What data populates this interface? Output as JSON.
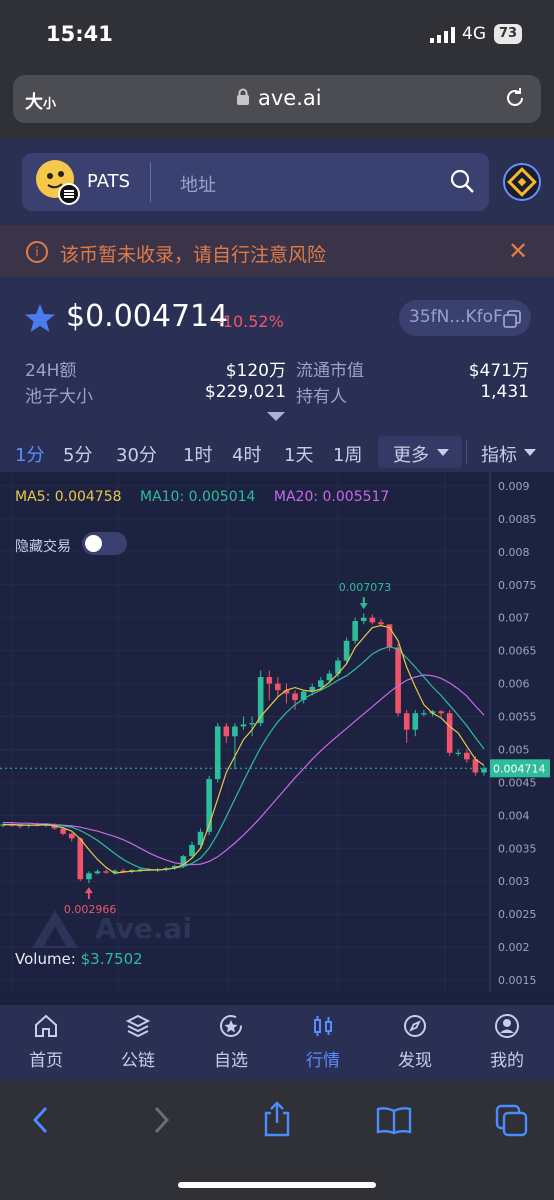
{
  "status_bar": {
    "time": "15:41",
    "network": "4G",
    "battery": "73"
  },
  "browser": {
    "text_size_label": "大",
    "text_size_small": "小",
    "domain": "ave.ai"
  },
  "header": {
    "coin_name": "PATS",
    "search_placeholder": "地址"
  },
  "warning": {
    "text": "该币暂未收录，请自行注意风险"
  },
  "price": {
    "value": "$0.004714",
    "change": "-10.52%",
    "address": "35fN...KfoF"
  },
  "stats": {
    "vol_label": "24H额",
    "vol_value": "$120万",
    "mcap_label": "流通市值",
    "mcap_value": "$471万",
    "pool_label": "池子大小",
    "pool_value": "$229,021",
    "holders_label": "持有人",
    "holders_value": "1,431"
  },
  "timeframes": [
    "1分",
    "5分",
    "30分",
    "1时",
    "4时",
    "1天",
    "1周"
  ],
  "timeframe_active": "1分",
  "more_label": "更多",
  "indicator_label": "指标",
  "chart_overlay": {
    "ma5": "MA5: 0.004758",
    "ma10": "MA10: 0.005014",
    "ma20": "MA20: 0.005517",
    "hide_trades": "隐藏交易",
    "volume_label": "Volume:",
    "volume_value": "$3.7502",
    "watermark": "Ave.ai"
  },
  "chart_data": {
    "type": "candlestick",
    "ylim": [
      0.0015,
      0.009
    ],
    "yticks": [
      "0.009",
      "0.0085",
      "0.008",
      "0.0075",
      "0.007",
      "0.0065",
      "0.006",
      "0.0055",
      "0.005",
      "0.0045",
      "0.004",
      "0.0035",
      "0.003",
      "0.0025",
      "0.002",
      "0.0015"
    ],
    "current_price": "0.004714",
    "high_label": "0.007073",
    "low_label": "0.002966",
    "series_ohlc": [
      [
        0.00385,
        0.00388,
        0.00382,
        0.00386
      ],
      [
        0.00386,
        0.0039,
        0.00383,
        0.00385
      ],
      [
        0.00385,
        0.00387,
        0.0038,
        0.00384
      ],
      [
        0.00384,
        0.00388,
        0.00381,
        0.00386
      ],
      [
        0.00386,
        0.00389,
        0.00383,
        0.00385
      ],
      [
        0.00385,
        0.00387,
        0.00382,
        0.00386
      ],
      [
        0.00386,
        0.00388,
        0.00378,
        0.0038
      ],
      [
        0.0038,
        0.00382,
        0.0037,
        0.00372
      ],
      [
        0.00372,
        0.00374,
        0.0036,
        0.00365
      ],
      [
        0.00365,
        0.00367,
        0.003,
        0.00303
      ],
      [
        0.00303,
        0.00315,
        0.00297,
        0.00312
      ],
      [
        0.00312,
        0.00318,
        0.0031,
        0.00315
      ],
      [
        0.00315,
        0.00318,
        0.00311,
        0.00313
      ],
      [
        0.00313,
        0.00318,
        0.0031,
        0.00316
      ],
      [
        0.00316,
        0.00319,
        0.00312,
        0.00315
      ],
      [
        0.00315,
        0.00318,
        0.00312,
        0.00317
      ],
      [
        0.00317,
        0.0032,
        0.00314,
        0.00318
      ],
      [
        0.00318,
        0.0032,
        0.00315,
        0.00317
      ],
      [
        0.00317,
        0.0032,
        0.00314,
        0.00318
      ],
      [
        0.00318,
        0.00322,
        0.00315,
        0.0032
      ],
      [
        0.0032,
        0.00325,
        0.00317,
        0.00323
      ],
      [
        0.00323,
        0.0034,
        0.0032,
        0.00338
      ],
      [
        0.00338,
        0.0036,
        0.00335,
        0.00355
      ],
      [
        0.00355,
        0.0038,
        0.0035,
        0.00375
      ],
      [
        0.00375,
        0.0046,
        0.0037,
        0.00455
      ],
      [
        0.00455,
        0.0054,
        0.0045,
        0.00535
      ],
      [
        0.00535,
        0.0054,
        0.0051,
        0.0052
      ],
      [
        0.0052,
        0.0054,
        0.0047,
        0.00535
      ],
      [
        0.00535,
        0.0055,
        0.0053,
        0.00538
      ],
      [
        0.00538,
        0.0055,
        0.0052,
        0.0054
      ],
      [
        0.0054,
        0.0062,
        0.00535,
        0.0061
      ],
      [
        0.0061,
        0.0062,
        0.00575,
        0.006
      ],
      [
        0.006,
        0.0061,
        0.0058,
        0.0059
      ],
      [
        0.0059,
        0.006,
        0.0057,
        0.00585
      ],
      [
        0.00585,
        0.0059,
        0.0056,
        0.00575
      ],
      [
        0.00575,
        0.0059,
        0.0057,
        0.00588
      ],
      [
        0.00588,
        0.006,
        0.00582,
        0.00595
      ],
      [
        0.00595,
        0.0061,
        0.0059,
        0.00605
      ],
      [
        0.00605,
        0.0062,
        0.006,
        0.00615
      ],
      [
        0.00615,
        0.0064,
        0.0061,
        0.00635
      ],
      [
        0.00635,
        0.0067,
        0.0063,
        0.00665
      ],
      [
        0.00665,
        0.007,
        0.0066,
        0.00695
      ],
      [
        0.00695,
        0.00707,
        0.0069,
        0.007
      ],
      [
        0.007,
        0.00705,
        0.0069,
        0.00693
      ],
      [
        0.00693,
        0.00698,
        0.00688,
        0.0069
      ],
      [
        0.0069,
        0.0069,
        0.0065,
        0.00655
      ],
      [
        0.00655,
        0.0066,
        0.0055,
        0.00555
      ],
      [
        0.00555,
        0.0056,
        0.0051,
        0.0053
      ],
      [
        0.0053,
        0.0056,
        0.0052,
        0.00555
      ],
      [
        0.00555,
        0.0056,
        0.0055,
        0.00555
      ],
      [
        0.00555,
        0.0056,
        0.0055,
        0.00558
      ],
      [
        0.00558,
        0.0056,
        0.0055,
        0.00555
      ],
      [
        0.00555,
        0.0056,
        0.0049,
        0.00495
      ],
      [
        0.00495,
        0.005,
        0.0049,
        0.00495
      ],
      [
        0.00495,
        0.005,
        0.0048,
        0.00485
      ],
      [
        0.00485,
        0.0049,
        0.0046,
        0.00465
      ],
      [
        0.00465,
        0.00475,
        0.0046,
        0.00471
      ]
    ],
    "ma5": [
      0.00386,
      0.00386,
      0.00385,
      0.00385,
      0.00385,
      0.00386,
      0.00384,
      0.00381,
      0.00376,
      0.00364,
      0.00348,
      0.00333,
      0.00321,
      0.00312,
      0.00314,
      0.00315,
      0.00316,
      0.00317,
      0.00317,
      0.00318,
      0.0032,
      0.00325,
      0.00335,
      0.0035,
      0.00385,
      0.00425,
      0.00465,
      0.0049,
      0.00515,
      0.0053,
      0.0055,
      0.00565,
      0.0058,
      0.0059,
      0.00594,
      0.0059,
      0.00588,
      0.00592,
      0.00602,
      0.00615,
      0.0063,
      0.00655,
      0.0067,
      0.00685,
      0.00688,
      0.00685,
      0.00665,
      0.00625,
      0.00595,
      0.00568,
      0.00555,
      0.00548,
      0.00535,
      0.00525,
      0.00505,
      0.00485,
      0.00476
    ],
    "ma10": [
      0.00386,
      0.00386,
      0.00386,
      0.00385,
      0.00385,
      0.00385,
      0.00385,
      0.00384,
      0.00382,
      0.00377,
      0.0037,
      0.00362,
      0.00352,
      0.00342,
      0.00333,
      0.00326,
      0.0032,
      0.00318,
      0.00317,
      0.00318,
      0.0032,
      0.00322,
      0.00327,
      0.00335,
      0.0035,
      0.00372,
      0.00398,
      0.00425,
      0.00452,
      0.00478,
      0.00503,
      0.00524,
      0.00542,
      0.00556,
      0.00568,
      0.00577,
      0.00584,
      0.0059,
      0.00597,
      0.00605,
      0.00612,
      0.00622,
      0.00633,
      0.00645,
      0.00652,
      0.00656,
      0.00652,
      0.00639,
      0.00625,
      0.0061,
      0.00595,
      0.00582,
      0.00567,
      0.00552,
      0.00536,
      0.00518,
      0.00501
    ],
    "ma20": [
      0.00389,
      0.00389,
      0.00388,
      0.00388,
      0.00387,
      0.00387,
      0.00386,
      0.00385,
      0.00384,
      0.00382,
      0.00379,
      0.00376,
      0.00372,
      0.00368,
      0.00363,
      0.00357,
      0.0035,
      0.00343,
      0.00337,
      0.00332,
      0.00328,
      0.00326,
      0.00325,
      0.00326,
      0.0033,
      0.00337,
      0.00347,
      0.00358,
      0.0037,
      0.00383,
      0.00397,
      0.00412,
      0.00427,
      0.00442,
      0.00457,
      0.00471,
      0.00485,
      0.00498,
      0.0051,
      0.00521,
      0.00532,
      0.00543,
      0.00554,
      0.00565,
      0.00576,
      0.00587,
      0.00597,
      0.00605,
      0.0061,
      0.00613,
      0.00612,
      0.00608,
      0.00601,
      0.00592,
      0.00581,
      0.00566,
      0.00552
    ]
  },
  "bottom_nav": [
    {
      "label": "首页",
      "icon": "home-icon"
    },
    {
      "label": "公链",
      "icon": "layers-icon"
    },
    {
      "label": "自选",
      "icon": "star-badge-icon"
    },
    {
      "label": "行情",
      "icon": "candlestick-icon"
    },
    {
      "label": "发现",
      "icon": "compass-icon"
    },
    {
      "label": "我的",
      "icon": "user-icon"
    }
  ],
  "bottom_nav_active": "行情",
  "colors": {
    "up": "#2ebd9a",
    "down": "#f0546a",
    "accent": "#5b8cff",
    "ma5": "#e8c84a",
    "ma10": "#2ebd9a",
    "ma20": "#c86ae8",
    "warning": "#e07b49"
  }
}
